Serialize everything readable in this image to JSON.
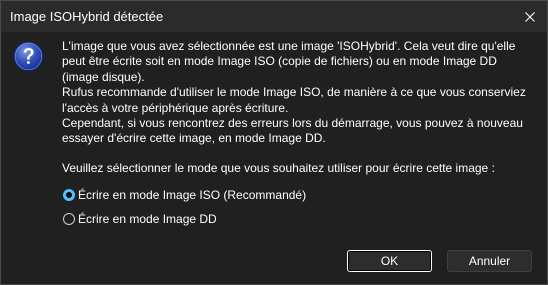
{
  "window": {
    "title": "Image ISOHybrid détectée"
  },
  "message": {
    "paragraph1": "L'image que vous avez sélectionnée est une image 'ISOHybrid'. Cela veut dire qu'elle peut être écrite soit en mode Image ISO (copie de fichiers) ou en mode Image DD (image disque).",
    "paragraph2": "Rufus recommande d'utiliser le mode Image ISO, de manière à ce que vous conserviez l'accès à votre périphérique après écriture.",
    "paragraph3": "Cependant, si vous rencontrez des erreurs lors du démarrage, vous pouvez à nouveau essayer d'écrire cette image, en mode Image DD."
  },
  "prompt": "Veuillez sélectionner le mode que vous souhaitez utiliser pour écrire cette image :",
  "options": [
    {
      "label": "Écrire en mode Image ISO (Recommandé)",
      "selected": true
    },
    {
      "label": "Écrire en mode Image DD",
      "selected": false
    }
  ],
  "buttons": {
    "ok": "OK",
    "cancel": "Annuler"
  },
  "icons": {
    "dialog": "question-icon",
    "close": "close-icon"
  },
  "colors": {
    "accent": "#4cc2ff",
    "background": "#202020",
    "titlebar": "#2b2b2b"
  }
}
